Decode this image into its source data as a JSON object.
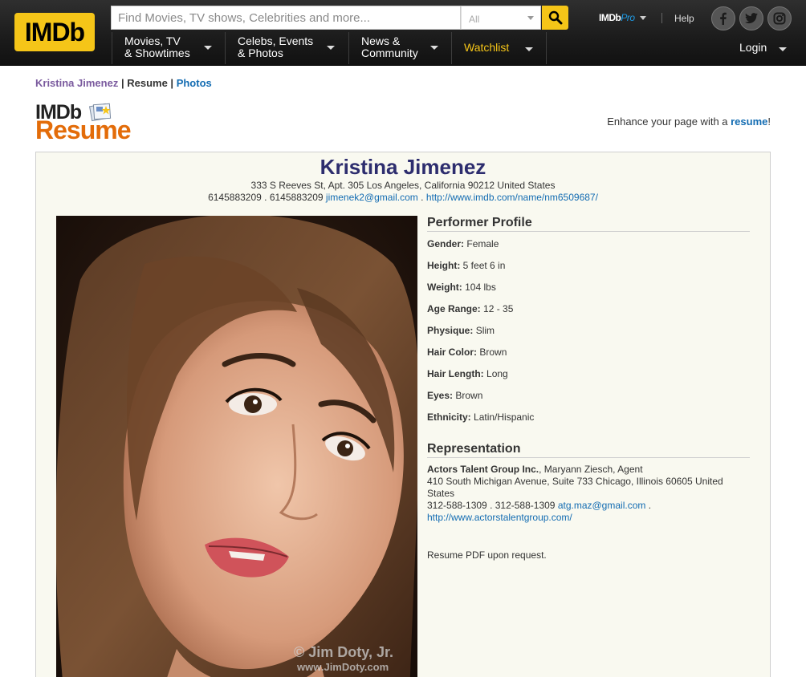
{
  "navbar": {
    "logo": "IMDb",
    "search_placeholder": "Find Movies, TV shows, Celebrities and more...",
    "search_category": "All",
    "imdbpro_main": "IMDb",
    "imdbpro_pro": "Pro",
    "help": "Help",
    "menus": [
      {
        "line1": "Movies, TV",
        "line2": "& Showtimes"
      },
      {
        "line1": "Celebs, Events",
        "line2": "& Photos"
      },
      {
        "line1": "News &",
        "line2": "Community"
      }
    ],
    "watchlist": "Watchlist",
    "login": "Login",
    "social_icons": [
      "facebook-icon",
      "twitter-icon",
      "instagram-icon"
    ]
  },
  "subnav": {
    "name": "Kristina Jimenez",
    "sep": "|",
    "resume": "Resume",
    "photos": "Photos"
  },
  "resume_header": {
    "logo_top": "IMDb",
    "logo_bottom": "Resume",
    "enhance_prefix": "Enhance your page with a ",
    "enhance_link": "resume",
    "enhance_suffix": "!"
  },
  "profile": {
    "name": "Kristina Jimenez",
    "address": "333 S Reeves St, Apt. 305 Los Angeles, California 90212 United States",
    "phones": "6145883209 . 6145883209",
    "email": "jimenek2@gmail.com",
    "dot": " . ",
    "url": "http://www.imdb.com/name/nm6509687/",
    "photo_credit_line1": "© Jim Doty, Jr.",
    "photo_credit_line2": "www.JimDoty.com"
  },
  "performer_profile": {
    "title": "Performer Profile",
    "attributes": [
      {
        "label": "Gender:",
        "value": "Female"
      },
      {
        "label": "Height:",
        "value": "5 feet 6 in"
      },
      {
        "label": "Weight:",
        "value": "104 lbs"
      },
      {
        "label": "Age Range:",
        "value": "12 - 35"
      },
      {
        "label": "Physique:",
        "value": "Slim"
      },
      {
        "label": "Hair Color:",
        "value": "Brown"
      },
      {
        "label": "Hair Length:",
        "value": "Long"
      },
      {
        "label": "Eyes:",
        "value": "Brown"
      },
      {
        "label": "Ethnicity:",
        "value": "Latin/Hispanic"
      }
    ]
  },
  "representation": {
    "title": "Representation",
    "agency": "Actors Talent Group Inc.",
    "agent": ", Maryann Ziesch, Agent",
    "address_line1": "410 South Michigan Avenue, Suite 733 Chicago, Illinois 60605 United",
    "address_line2": "States",
    "phones": "312-588-1309 . 312-588-1309",
    "email": "atg.maz@gmail.com",
    "email_suffix": " .",
    "url": "http://www.actorstalentgroup.com/",
    "note": "Resume PDF upon request."
  }
}
